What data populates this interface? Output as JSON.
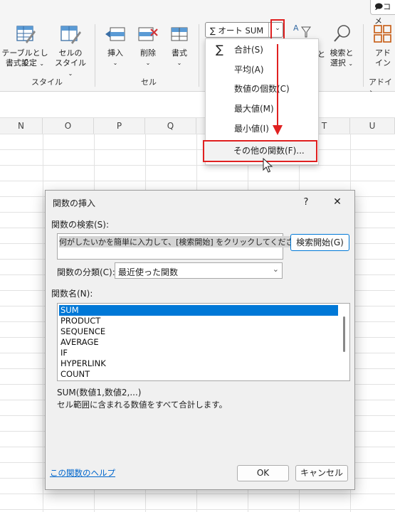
{
  "ribbon": {
    "comment_button": "コメ",
    "styles": {
      "table_format": [
        "テーブルとして",
        "書式設定"
      ],
      "cell_styles": [
        "セルの",
        "スタイル"
      ],
      "group_label": "スタイル"
    },
    "cells": {
      "insert": "挿入",
      "delete": "削除",
      "format": "書式",
      "group_label": "セル"
    },
    "editing": {
      "autosum_label": "∑ オート SUM",
      "find_select": [
        "検索と",
        "選択"
      ],
      "partial_label": "と"
    },
    "addins": {
      "label": [
        "アド",
        "イン"
      ],
      "group_label": "アドイン"
    }
  },
  "columns": [
    "N",
    "O",
    "P",
    "Q",
    "R",
    "S",
    "T",
    "U"
  ],
  "dropdown": {
    "items": [
      {
        "label": "合計(S)",
        "icon": "sigma"
      },
      {
        "label": "平均(A)"
      },
      {
        "label": "数値の個数(C)"
      },
      {
        "label": "最大値(M)"
      },
      {
        "label": "最小値(I)"
      },
      {
        "label": "その他の関数(F)...",
        "highlighted": true
      }
    ]
  },
  "dialog": {
    "title": "関数の挿入",
    "help_glyph": "?",
    "close_glyph": "✕",
    "search_label": "関数の検索(S):",
    "search_value": "何がしたいかを簡単に入力して、[検索開始] をクリックしてください。",
    "search_button": "検索開始(G)",
    "category_label": "関数の分類(C):",
    "category_value": "最近使った関数",
    "function_list_label": "関数名(N):",
    "functions": [
      "SUM",
      "PRODUCT",
      "SEQUENCE",
      "AVERAGE",
      "IF",
      "HYPERLINK",
      "COUNT"
    ],
    "selected_function": "SUM",
    "syntax": "SUM(数値1,数値2,...)",
    "description": "セル範囲に含まれる数値をすべて合計します。",
    "help_link": "この関数のヘルプ",
    "ok_button": "OK",
    "cancel_button": "キャンセル"
  },
  "colors": {
    "highlight_red": "#e02020",
    "selection_blue": "#0078d7",
    "link_blue": "#0066cc",
    "accent_orange": "#c65a11"
  }
}
